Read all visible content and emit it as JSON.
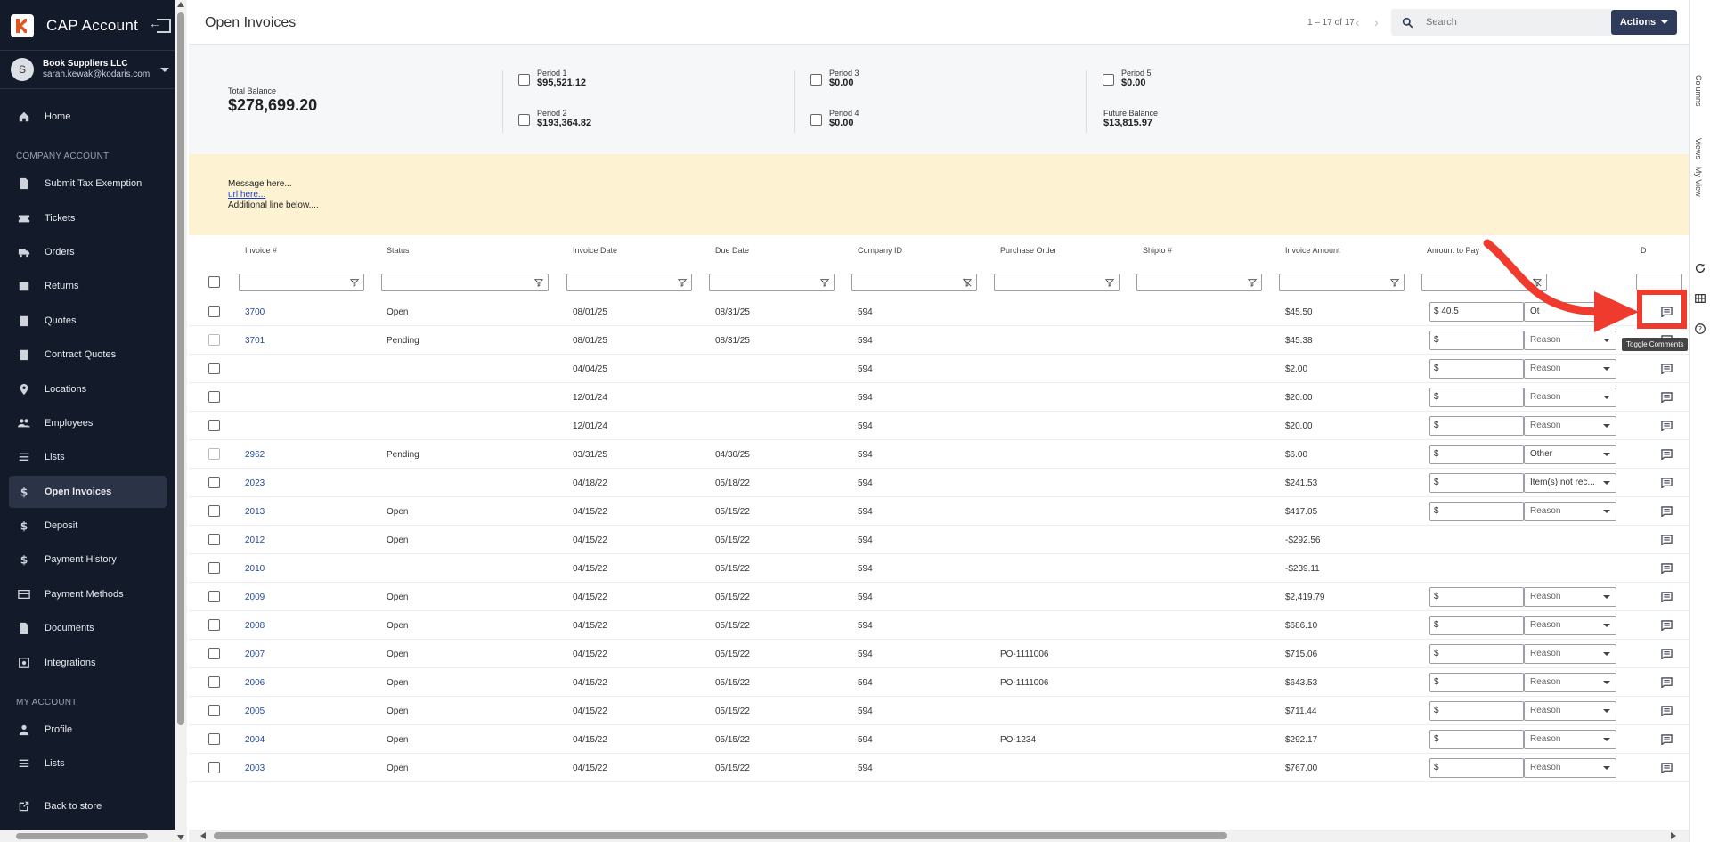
{
  "sidebar": {
    "brand_title": "CAP Account",
    "account": {
      "initial": "S",
      "name": "Book Suppliers LLC",
      "email": "sarah.kewak@kodaris.com"
    },
    "section_company": "COMPANY ACCOUNT",
    "section_my": "MY ACCOUNT",
    "items": [
      {
        "label": "Home",
        "icon": "home-icon"
      },
      {
        "label": "Submit Tax Exemption",
        "icon": "document-icon"
      },
      {
        "label": "Tickets",
        "icon": "ticket-icon"
      },
      {
        "label": "Orders",
        "icon": "truck-icon"
      },
      {
        "label": "Returns",
        "icon": "return-box-icon"
      },
      {
        "label": "Quotes",
        "icon": "clipboard-icon"
      },
      {
        "label": "Contract Quotes",
        "icon": "clipboard-icon"
      },
      {
        "label": "Locations",
        "icon": "location-pin-icon"
      },
      {
        "label": "Employees",
        "icon": "people-icon"
      },
      {
        "label": "Lists",
        "icon": "list-icon"
      },
      {
        "label": "Open Invoices",
        "icon": "dollar-icon"
      },
      {
        "label": "Deposit",
        "icon": "dollar-icon"
      },
      {
        "label": "Payment History",
        "icon": "dollar-icon"
      },
      {
        "label": "Payment Methods",
        "icon": "credit-card-icon"
      },
      {
        "label": "Documents",
        "icon": "document-icon"
      },
      {
        "label": "Integrations",
        "icon": "integration-icon"
      },
      {
        "label": "Profile",
        "icon": "person-icon"
      },
      {
        "label": "Lists",
        "icon": "list-icon"
      },
      {
        "label": "Back to store",
        "icon": "external-link-icon"
      }
    ],
    "active_item": "Open Invoices"
  },
  "header": {
    "title": "Open Invoices",
    "pager": "1 – 17 of 17",
    "search_placeholder": "Search",
    "actions_label": "Actions"
  },
  "summary": {
    "total_label": "Total Balance",
    "total_value": "$278,699.20",
    "periods": [
      {
        "label": "Period 1",
        "value": "$95,521.12"
      },
      {
        "label": "Period 2",
        "value": "$193,364.82"
      },
      {
        "label": "Period 3",
        "value": "$0.00"
      },
      {
        "label": "Period 4",
        "value": "$0.00"
      },
      {
        "label": "Period 5",
        "value": "$0.00"
      }
    ],
    "future_label": "Future Balance",
    "future_value": "$13,815.97"
  },
  "banner": {
    "line1": "Message here...",
    "link": "url here...",
    "line3": "Additional line below...."
  },
  "table": {
    "columns": [
      "Invoice #",
      "Status",
      "Invoice Date",
      "Due Date",
      "Company ID",
      "Purchase Order",
      "Shipto #",
      "Invoice Amount",
      "Amount to Pay",
      "D"
    ],
    "rows": [
      {
        "invoice": "3700",
        "status": "Open",
        "inv_date": "08/01/25",
        "due_date": "08/31/25",
        "company": "594",
        "po": "",
        "amount": "$45.50",
        "pay": "$ 40.5",
        "reason": "Ot",
        "pay_visible": true,
        "cb_dim": false
      },
      {
        "invoice": "3701",
        "status": "Pending",
        "inv_date": "08/01/25",
        "due_date": "08/31/25",
        "company": "594",
        "po": "",
        "amount": "$45.38",
        "pay": "$",
        "reason": "Reason",
        "pay_visible": true,
        "cb_dim": true
      },
      {
        "invoice": "",
        "status": "",
        "inv_date": "04/04/25",
        "due_date": "",
        "company": "594",
        "po": "",
        "amount": "$2.00",
        "pay": "$",
        "reason": "Reason",
        "pay_visible": true,
        "cb_dim": false
      },
      {
        "invoice": "",
        "status": "",
        "inv_date": "12/01/24",
        "due_date": "",
        "company": "594",
        "po": "",
        "amount": "$20.00",
        "pay": "$",
        "reason": "Reason",
        "pay_visible": true,
        "cb_dim": false
      },
      {
        "invoice": "",
        "status": "",
        "inv_date": "12/01/24",
        "due_date": "",
        "company": "594",
        "po": "",
        "amount": "$20.00",
        "pay": "$",
        "reason": "Reason",
        "pay_visible": true,
        "cb_dim": false
      },
      {
        "invoice": "2962",
        "status": "Pending",
        "inv_date": "03/31/25",
        "due_date": "04/30/25",
        "company": "594",
        "po": "",
        "amount": "$6.00",
        "pay": "$",
        "reason": "Other",
        "pay_visible": true,
        "cb_dim": true
      },
      {
        "invoice": "2023",
        "status": "",
        "inv_date": "04/18/22",
        "due_date": "05/18/22",
        "company": "594",
        "po": "",
        "amount": "$241.53",
        "pay": "$",
        "reason": "Item(s) not rec...",
        "pay_visible": true,
        "cb_dim": false
      },
      {
        "invoice": "2013",
        "status": "Open",
        "inv_date": "04/15/22",
        "due_date": "05/15/22",
        "company": "594",
        "po": "",
        "amount": "$417.05",
        "pay": "$",
        "reason": "Reason",
        "pay_visible": true,
        "cb_dim": false
      },
      {
        "invoice": "2012",
        "status": "Open",
        "inv_date": "04/15/22",
        "due_date": "05/15/22",
        "company": "594",
        "po": "",
        "amount": "-$292.56",
        "pay": "",
        "reason": "",
        "pay_visible": false,
        "cb_dim": false
      },
      {
        "invoice": "2010",
        "status": "",
        "inv_date": "04/15/22",
        "due_date": "05/15/22",
        "company": "594",
        "po": "",
        "amount": "-$239.11",
        "pay": "",
        "reason": "",
        "pay_visible": false,
        "cb_dim": false
      },
      {
        "invoice": "2009",
        "status": "Open",
        "inv_date": "04/15/22",
        "due_date": "05/15/22",
        "company": "594",
        "po": "",
        "amount": "$2,419.79",
        "pay": "$",
        "reason": "Reason",
        "pay_visible": true,
        "cb_dim": false
      },
      {
        "invoice": "2008",
        "status": "Open",
        "inv_date": "04/15/22",
        "due_date": "05/15/22",
        "company": "594",
        "po": "",
        "amount": "$686.10",
        "pay": "$",
        "reason": "Reason",
        "pay_visible": true,
        "cb_dim": false
      },
      {
        "invoice": "2007",
        "status": "Open",
        "inv_date": "04/15/22",
        "due_date": "05/15/22",
        "company": "594",
        "po": "PO-1111006",
        "amount": "$715.06",
        "pay": "$",
        "reason": "Reason",
        "pay_visible": true,
        "cb_dim": false
      },
      {
        "invoice": "2006",
        "status": "Open",
        "inv_date": "04/15/22",
        "due_date": "05/15/22",
        "company": "594",
        "po": "PO-1111006",
        "amount": "$643.53",
        "pay": "$",
        "reason": "Reason",
        "pay_visible": true,
        "cb_dim": false
      },
      {
        "invoice": "2005",
        "status": "Open",
        "inv_date": "04/15/22",
        "due_date": "05/15/22",
        "company": "594",
        "po": "",
        "amount": "$711.44",
        "pay": "$",
        "reason": "Reason",
        "pay_visible": true,
        "cb_dim": false
      },
      {
        "invoice": "2004",
        "status": "Open",
        "inv_date": "04/15/22",
        "due_date": "05/15/22",
        "company": "594",
        "po": "PO-1234",
        "amount": "$292.17",
        "pay": "$",
        "reason": "Reason",
        "pay_visible": true,
        "cb_dim": false
      },
      {
        "invoice": "2003",
        "status": "Open",
        "inv_date": "04/15/22",
        "due_date": "05/15/22",
        "company": "594",
        "po": "",
        "amount": "$767.00",
        "pay": "$",
        "reason": "Reason",
        "pay_visible": true,
        "cb_dim": false
      }
    ]
  },
  "tooltip": "Toggle Comments",
  "side_panel": {
    "columns": "Columns",
    "views": "Views - My View"
  },
  "colors": {
    "sidebar_bg": "#131a2a",
    "accent": "#2f3b5a",
    "highlight": "#ef3b2d",
    "banner_bg": "#fdf3d2",
    "link": "#234a9a"
  }
}
